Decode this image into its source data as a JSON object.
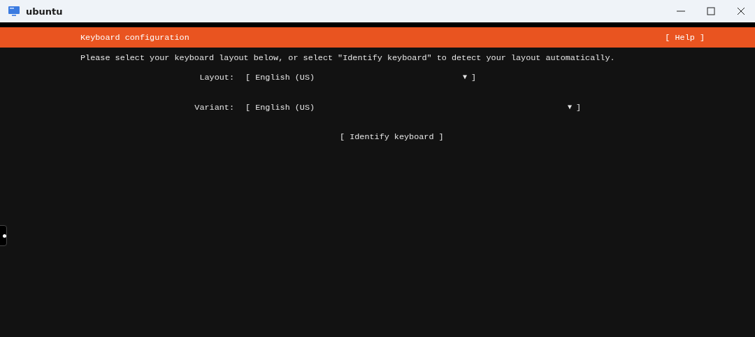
{
  "window": {
    "title": "ubuntu"
  },
  "header": {
    "title": "Keyboard configuration",
    "help": "[ Help ]"
  },
  "instructions": "Please select your keyboard layout below, or select \"Identify keyboard\" to detect your layout automatically.",
  "fields": [
    {
      "label": "Layout:",
      "open": "[",
      "value": "English (US)",
      "arrow": "▼",
      "close": "]",
      "wide": false
    },
    {
      "label": "Variant:",
      "open": "[",
      "value": "English (US)",
      "arrow": "▼",
      "close": "]",
      "wide": true
    }
  ],
  "identify_button": "[ Identify keyboard ]"
}
